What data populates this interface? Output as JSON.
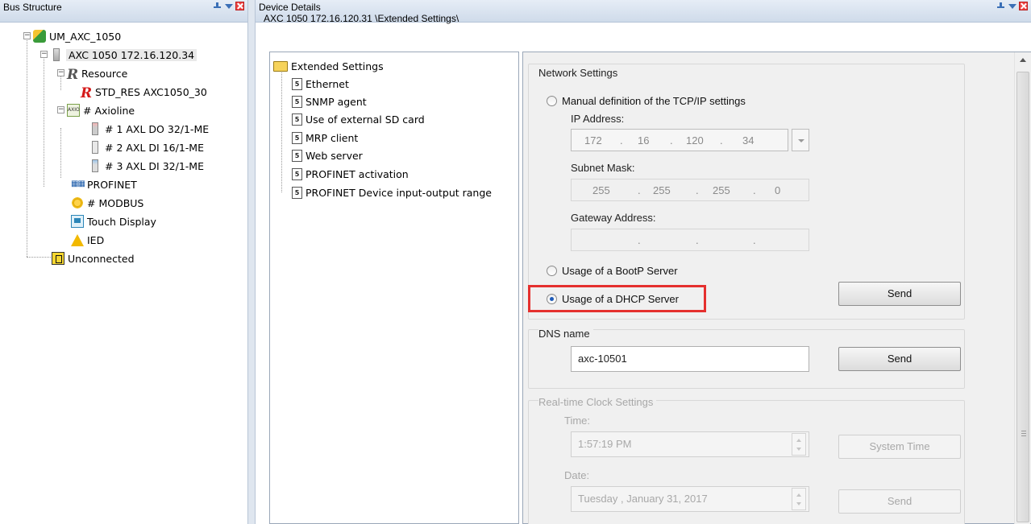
{
  "bus_structure": {
    "title": "Bus Structure",
    "tree": {
      "project": "UM_AXC_1050",
      "controller": "AXC 1050 172.16.120.34",
      "resource": "Resource",
      "std_res": "STD_RES AXC1050_30",
      "axioline": "# Axioline",
      "axioline_icon_text": "AXIO",
      "modules": [
        "# 1 AXL DO 32/1-ME",
        "# 2 AXL DI 16/1-ME",
        "# 3 AXL DI 32/1-ME"
      ],
      "profinet": "PROFINET",
      "modbus": "# MODBUS",
      "touch_display": "Touch Display",
      "ied": "IED",
      "unconnected": "Unconnected"
    }
  },
  "device_details": {
    "title": "Device Details",
    "path": "AXC 1050 172.16.120.31 \\Extended Settings\\",
    "settings_tree": {
      "root": "Extended Settings",
      "items": [
        "Ethernet",
        "SNMP agent",
        "Use of external SD card",
        "MRP client",
        "Web server",
        "PROFINET activation",
        "PROFINET Device input-output range"
      ]
    },
    "network_settings": {
      "title": "Network Settings",
      "manual_option": "Manual definition of the TCP/IP settings",
      "ip_label": "IP Address:",
      "ip": [
        "172",
        "16",
        "120",
        "34"
      ],
      "subnet_label": "Subnet Mask:",
      "subnet": [
        "255",
        "255",
        "255",
        "0"
      ],
      "gateway_label": "Gateway Address:",
      "dot": ".",
      "bootp_option": "Usage of a BootP Server",
      "dhcp_option": "Usage of a DHCP Server",
      "selected_option": "dhcp",
      "send_label": "Send"
    },
    "dns": {
      "title": "DNS name",
      "value": "axc-10501",
      "send_label": "Send"
    },
    "rtc": {
      "title": "Real-time Clock Settings",
      "time_label": "Time:",
      "time_value": "1:57:19 PM",
      "system_time_label": "System Time",
      "date_label": "Date:",
      "date_value": "Tuesday  ,   January   31, 2017",
      "send_label": "Send"
    }
  },
  "colors": {
    "highlight": "#e5302e",
    "radio_selected": "#1d5ab8",
    "header_gradient_top": "#e6edf6",
    "header_gradient_bottom": "#cfdbea"
  }
}
